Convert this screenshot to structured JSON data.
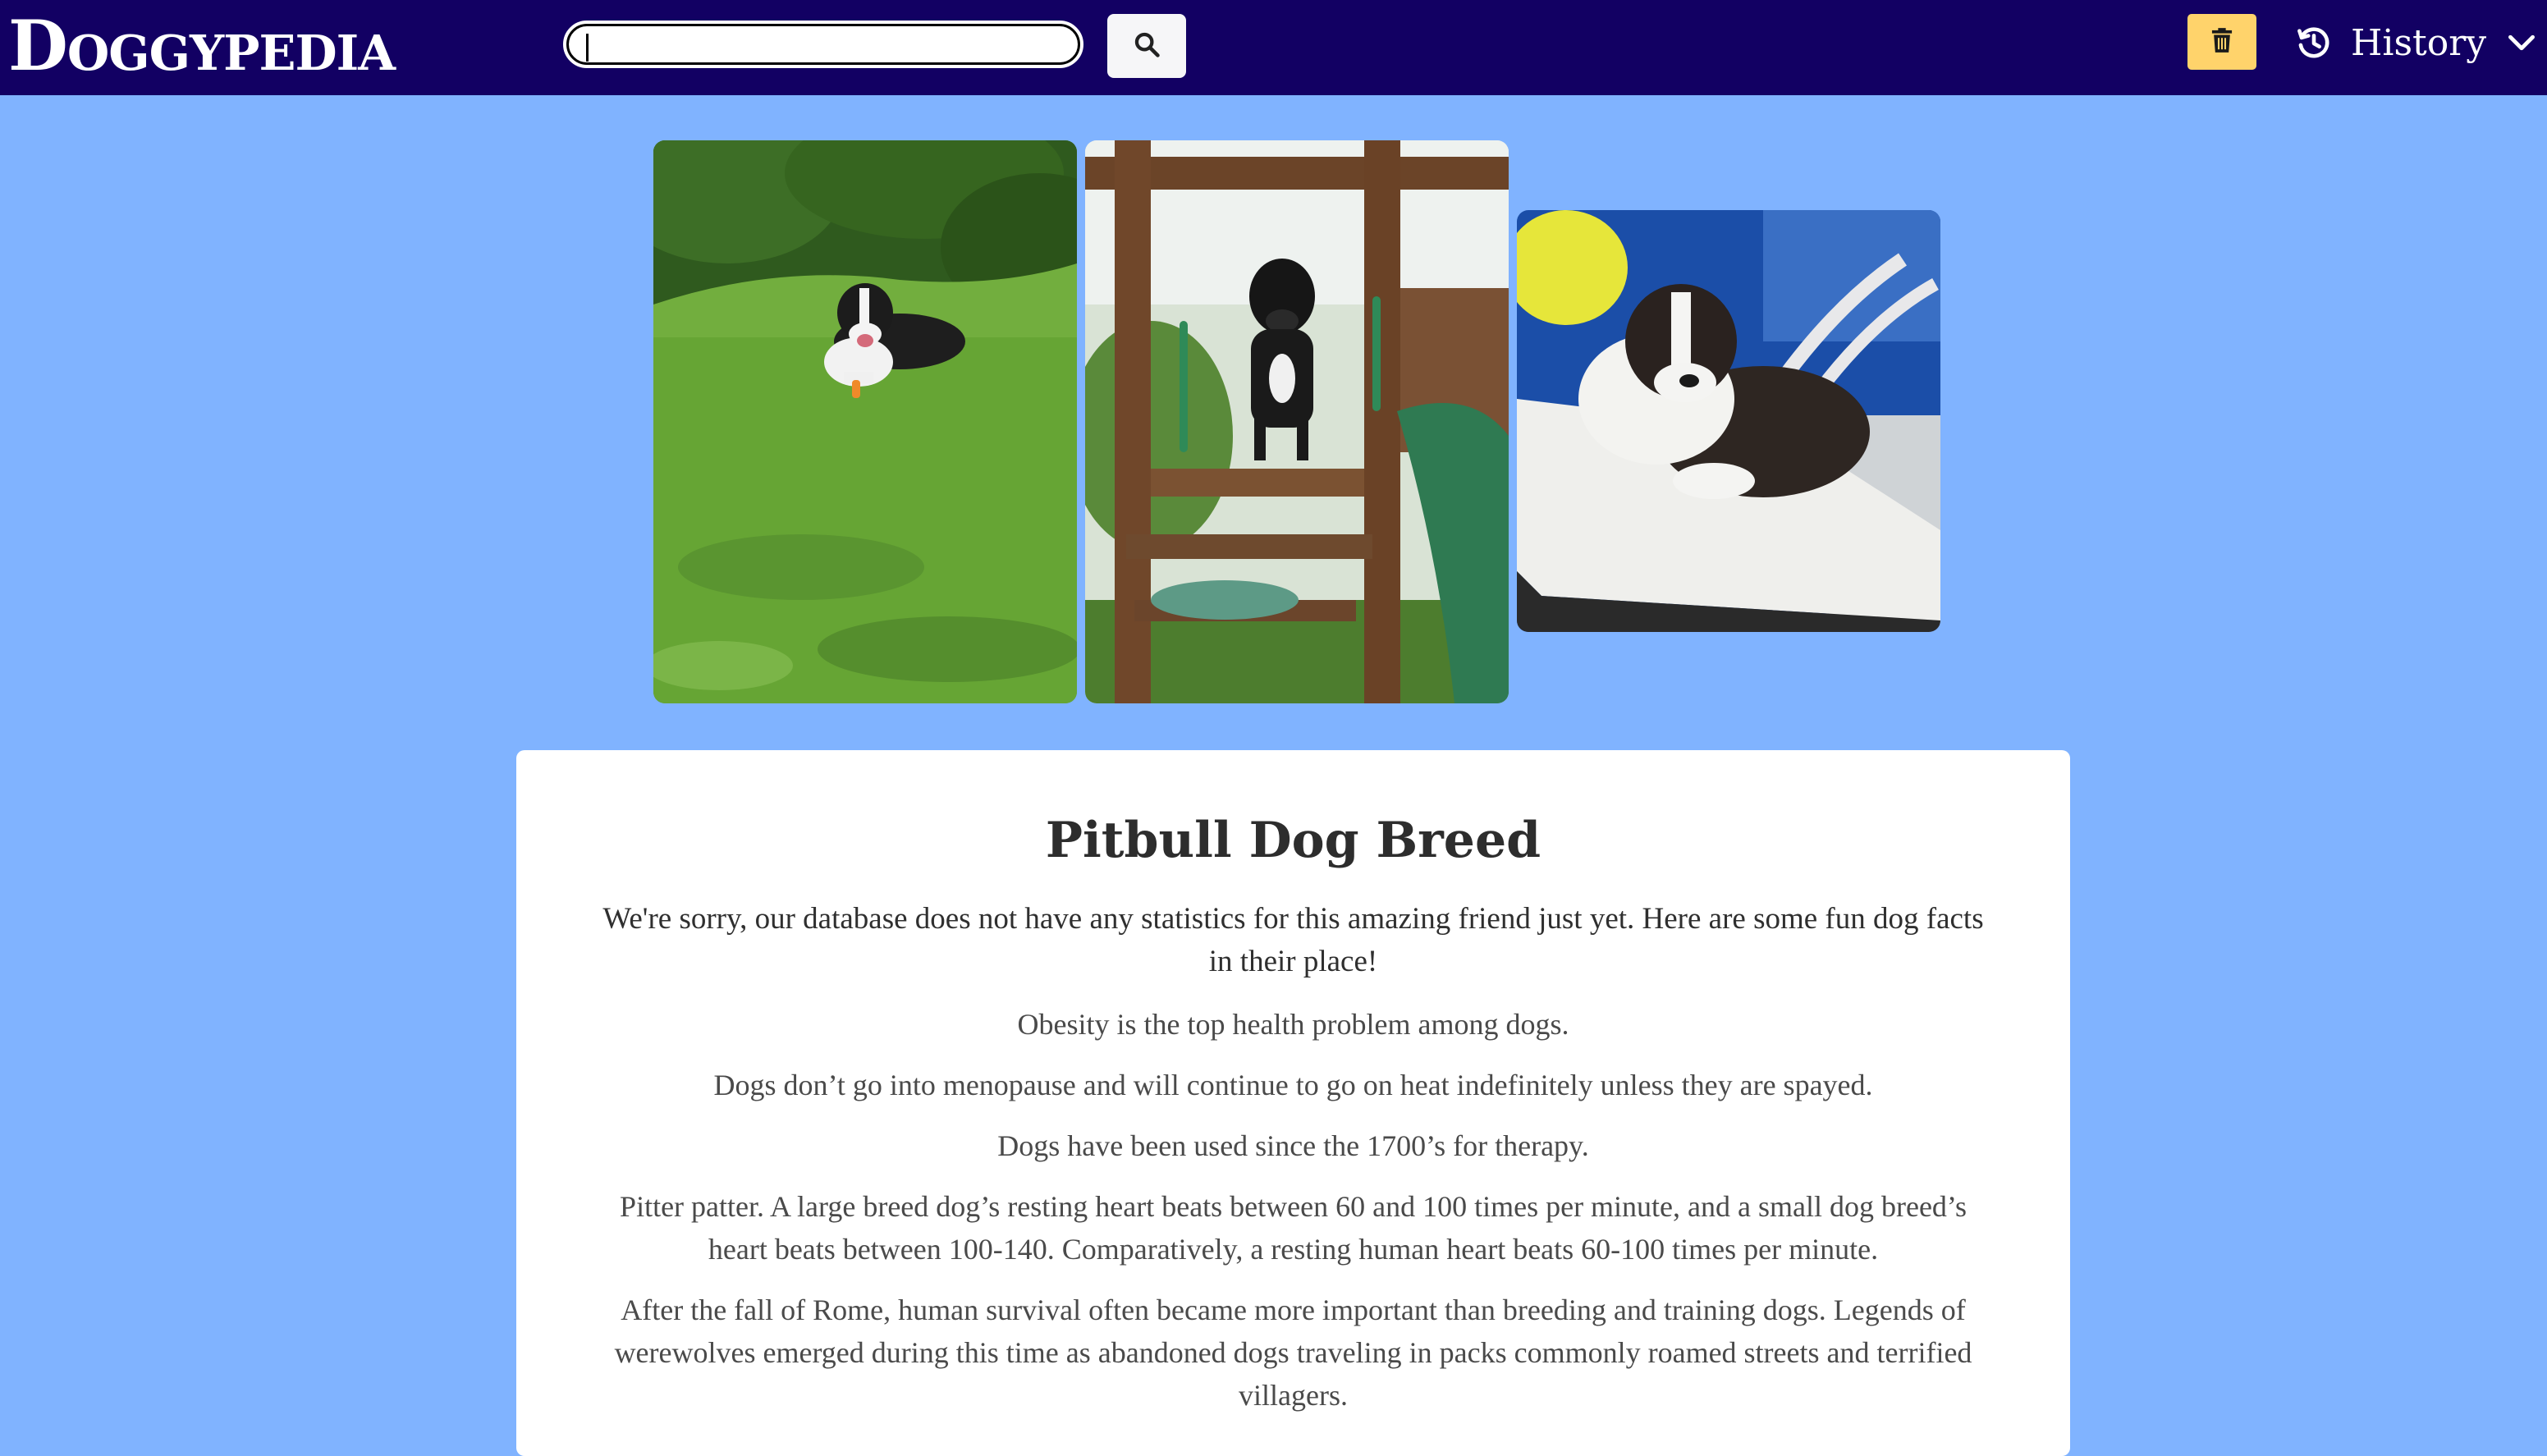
{
  "header": {
    "brand": "Doggypedia",
    "search_value": "",
    "history_label": "History",
    "icons": {
      "search": "search-icon",
      "trash": "trash-icon",
      "history": "history-icon",
      "dropdown": "chevron-down-icon"
    },
    "colors": {
      "navbar": "#120063",
      "trash_button": "#ffd36b",
      "page_background": "#80b3ff"
    }
  },
  "gallery": {
    "images": [
      {
        "name": "dog-photo-grass"
      },
      {
        "name": "dog-photo-playground"
      },
      {
        "name": "dog-photo-lounge-chair"
      }
    ]
  },
  "breed_card": {
    "title": "Pitbull Dog Breed",
    "intro": "We're sorry, our database does not have any statistics for this amazing friend just yet. Here are some fun dog facts in their place!",
    "facts": [
      "Obesity is the top health problem among dogs.",
      "Dogs don’t go into menopause and will continue to go on heat indefinitely unless they are spayed.",
      "Dogs have been used since the 1700’s for therapy.",
      "Pitter patter. A large breed dog’s resting heart beats between 60 and 100 times per minute, and a small dog breed’s heart beats between 100-140. Comparatively, a resting human heart beats 60-100 times per minute.",
      "After the fall of Rome, human survival often became more important than breeding and training dogs. Legends of werewolves emerged during this time as abandoned dogs traveling in packs commonly roamed streets and terrified villagers."
    ]
  }
}
